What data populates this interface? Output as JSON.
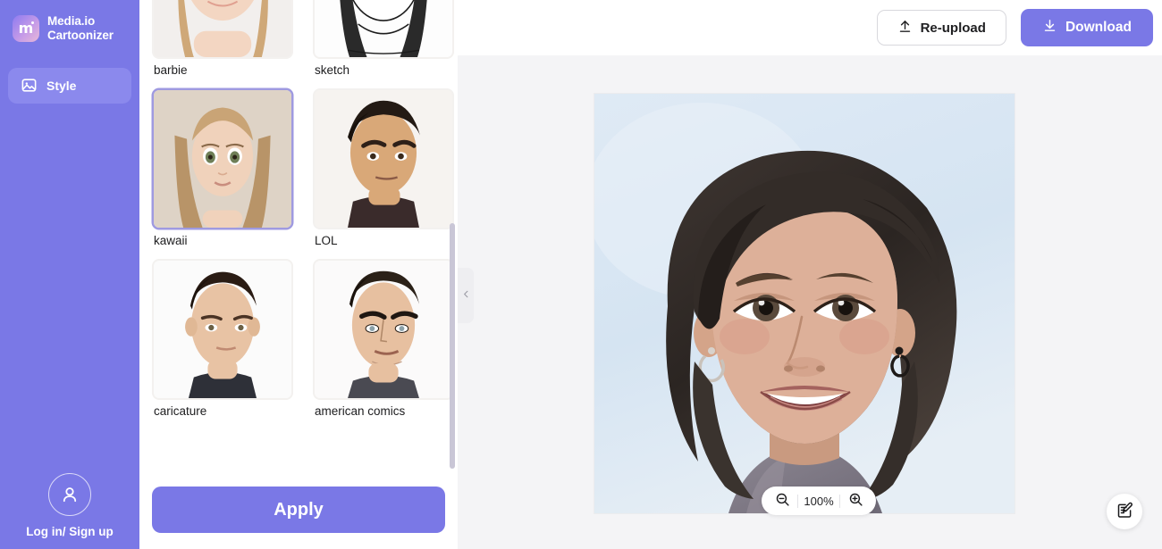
{
  "sidebar": {
    "brand": {
      "line1": "Media.io",
      "line2": "Cartoonizer",
      "logo_icon": "media-io-logo",
      "logo_glyph": "m"
    },
    "items": [
      {
        "label": "Style",
        "icon": "image-icon",
        "active": true
      }
    ],
    "account": {
      "label": "Log in/ Sign up",
      "icon": "user-avatar-icon"
    },
    "colors": {
      "background": "#7a78e6",
      "active_item": "#8b89ed"
    }
  },
  "style_panel": {
    "styles": [
      {
        "label": "barbie",
        "selected": false
      },
      {
        "label": "sketch",
        "selected": false
      },
      {
        "label": "kawaii",
        "selected": true
      },
      {
        "label": "LOL",
        "selected": false
      },
      {
        "label": "caricature",
        "selected": false
      },
      {
        "label": "american comics",
        "selected": false
      }
    ],
    "apply_label": "Apply",
    "selected_border_color": "#9f9ae0",
    "scrollbar": {
      "name": "style-list-scrollbar"
    }
  },
  "header": {
    "reupload_label": "Re-upload",
    "reupload_icon": "upload-icon",
    "download_label": "Download",
    "download_icon": "download-icon",
    "download_highlight_color": "#ec2024",
    "download_bg": "#7a78e6"
  },
  "canvas": {
    "preview": {
      "name": "cartoonized-portrait",
      "alt": "Cartoonized portrait of a smiling woman with dark hair on a light blue background"
    },
    "zoom": {
      "zoom_out_icon": "zoom-out-icon",
      "zoom_in_icon": "zoom-in-icon",
      "level": "100%"
    },
    "feedback_icon": "feedback-note-icon",
    "collapse_icon": "chevron-left-icon",
    "background": "#f4f4f6"
  }
}
